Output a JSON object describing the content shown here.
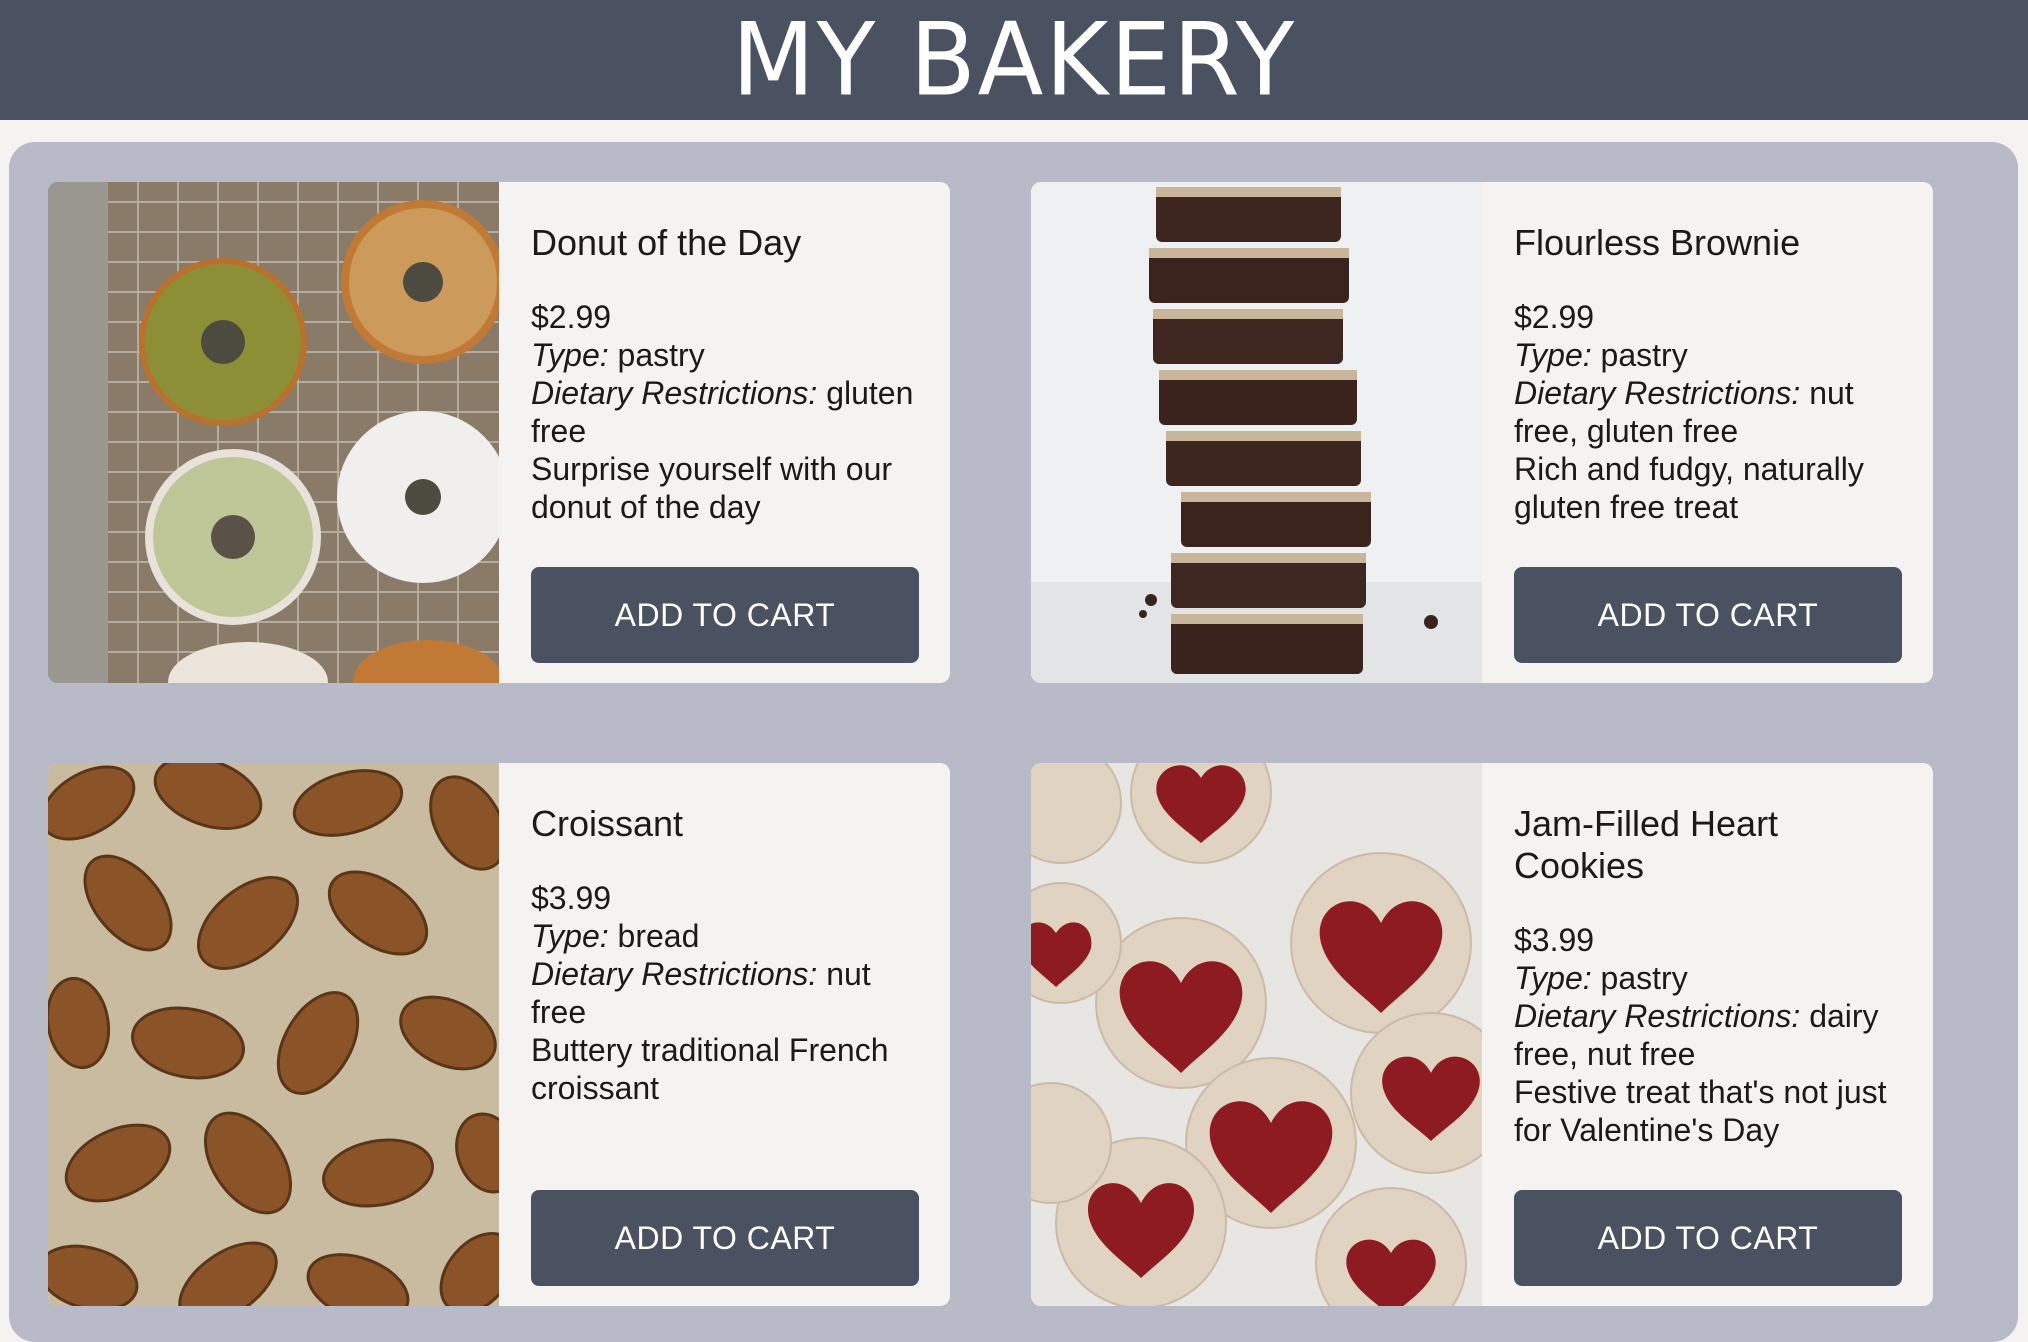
{
  "header": {
    "title": "MY BAKERY"
  },
  "products": [
    {
      "name": "Donut of the Day",
      "price": "$2.99",
      "type_label": "Type:",
      "type": "pastry",
      "diet_label": "Dietary Restrictions:",
      "diet": "gluten free",
      "description": "Surprise yourself with our donut of the day",
      "button": "ADD TO CART",
      "image": "donuts-photo"
    },
    {
      "name": "Flourless Brownie",
      "price": "$2.99",
      "type_label": "Type:",
      "type": "pastry",
      "diet_label": "Dietary Restrictions:",
      "diet": "nut free, gluten free",
      "description": "Rich and fudgy, naturally gluten free treat",
      "button": "ADD TO CART",
      "image": "brownie-stack-photo"
    },
    {
      "name": "Croissant",
      "price": "$3.99",
      "type_label": "Type:",
      "type": "bread",
      "diet_label": "Dietary Restrictions:",
      "diet": "nut free",
      "description": "Buttery traditional French croissant",
      "button": "ADD TO CART",
      "image": "croissants-photo"
    },
    {
      "name": "Jam-Filled Heart Cookies",
      "price": "$3.99",
      "type_label": "Type:",
      "type": "pastry",
      "diet_label": "Dietary Restrictions:",
      "diet": "dairy free, nut free",
      "description": "Festive treat that's not just for Valentine's Day",
      "button": "ADD TO CART",
      "image": "heart-cookies-photo"
    }
  ],
  "colors": {
    "header": "#4a5261",
    "panel": "#b8bac8",
    "card": "#f4f3f1",
    "button": "#4a5261"
  }
}
